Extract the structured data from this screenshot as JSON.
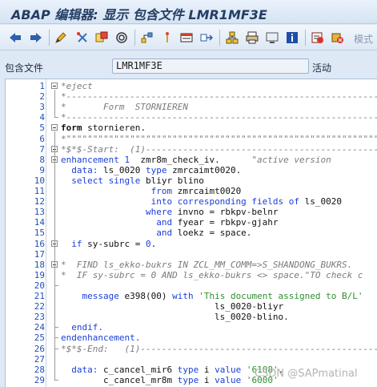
{
  "window": {
    "title": "ABAP 编辑器: 显示 包含文件 LMR1MF3E"
  },
  "toolbar": {
    "mode_label": "模式",
    "icons": [
      "back-arrow-icon",
      "forward-arrow-icon",
      "edit-pencil-icon",
      "toggle-display-change-icon",
      "where-used-icon",
      "check-icon",
      "hierarchy-icon",
      "activate-icon",
      "display-object-list-icon",
      "navigate-icon",
      "structure-icon",
      "print-icon",
      "screen-icon",
      "info-icon",
      "debug-icon",
      "delete-icon"
    ]
  },
  "infobar": {
    "label": "包含文件",
    "name": "LMR1MF3E",
    "status": "活动"
  },
  "lines": [
    {
      "n": "1",
      "fold": true,
      "parts": [
        {
          "c": "cm",
          "t": "*eject"
        }
      ]
    },
    {
      "n": "2",
      "parts": [
        {
          "c": "cm",
          "t": "*---------------------------------------------------------------------"
        }
      ]
    },
    {
      "n": "3",
      "parts": [
        {
          "c": "cm",
          "t": "*       Form  STORNIEREN"
        }
      ]
    },
    {
      "n": "4",
      "parts": [
        {
          "c": "cm",
          "t": "*---------------------------------------------------------------------"
        }
      ]
    },
    {
      "n": "5",
      "fold": true,
      "parts": [
        {
          "c": "bold",
          "t": "form"
        },
        {
          "c": "tx",
          "t": " stornieren."
        }
      ]
    },
    {
      "n": "6",
      "parts": [
        {
          "c": "cm",
          "t": "*\"\"\"\"\"\"\"\"\"\"\"\"\"\"\"\"\"\"\"\"\"\"\"\"\"\"\"\"\"\"\"\"\"\"\"\"\"\"\"\"\"\"\"\"\"\"\"\"\"\"\"\"\"\"\"\"\"\"\"\"\"\"\"\"\""
        }
      ]
    },
    {
      "n": "7",
      "fold": true,
      "parts": [
        {
          "c": "cm",
          "t": "*$*$-Start:  (1)-----------------------------------------------"
        }
      ]
    },
    {
      "n": "8",
      "fold": true,
      "parts": [
        {
          "c": "kw",
          "t": "enhancement"
        },
        {
          "c": "tx",
          "t": " "
        },
        {
          "c": "nm",
          "t": "1"
        },
        {
          "c": "tx",
          "t": "  zmr8m_check_iv.      "
        },
        {
          "c": "cm",
          "t": "\"active version"
        }
      ]
    },
    {
      "n": "9",
      "parts": [
        {
          "c": "tx",
          "t": "  "
        },
        {
          "c": "kw",
          "t": "data:"
        },
        {
          "c": "tx",
          "t": " ls_0020 "
        },
        {
          "c": "kw",
          "t": "type"
        },
        {
          "c": "tx",
          "t": " zmrcaimt0020."
        }
      ]
    },
    {
      "n": "10",
      "parts": [
        {
          "c": "tx",
          "t": "  "
        },
        {
          "c": "kw",
          "t": "select single"
        },
        {
          "c": "tx",
          "t": " bliyr blino"
        }
      ]
    },
    {
      "n": "11",
      "parts": [
        {
          "c": "tx",
          "t": "                 "
        },
        {
          "c": "kw",
          "t": "from"
        },
        {
          "c": "tx",
          "t": " zmrcaimt0020"
        }
      ]
    },
    {
      "n": "12",
      "parts": [
        {
          "c": "tx",
          "t": "                 "
        },
        {
          "c": "kw",
          "t": "into corresponding fields of"
        },
        {
          "c": "tx",
          "t": " ls_0020"
        }
      ]
    },
    {
      "n": "13",
      "parts": [
        {
          "c": "tx",
          "t": "                "
        },
        {
          "c": "kw",
          "t": "where"
        },
        {
          "c": "tx",
          "t": " invno = rbkpv-belnr"
        }
      ]
    },
    {
      "n": "14",
      "parts": [
        {
          "c": "tx",
          "t": "                  "
        },
        {
          "c": "kw",
          "t": "and"
        },
        {
          "c": "tx",
          "t": " fyear = rbkpv-gjahr"
        }
      ]
    },
    {
      "n": "15",
      "parts": [
        {
          "c": "tx",
          "t": "                  "
        },
        {
          "c": "kw",
          "t": "and"
        },
        {
          "c": "tx",
          "t": " loekz = space."
        }
      ]
    },
    {
      "n": "16",
      "fold": true,
      "parts": [
        {
          "c": "tx",
          "t": "  "
        },
        {
          "c": "kw",
          "t": "if"
        },
        {
          "c": "tx",
          "t": " sy-subrc = "
        },
        {
          "c": "nm",
          "t": "0"
        },
        {
          "c": "tx",
          "t": "."
        }
      ]
    },
    {
      "n": "17",
      "parts": []
    },
    {
      "n": "18",
      "fold": true,
      "parts": [
        {
          "c": "cm",
          "t": "*  FIND ls_ekko-bukrs IN ZCL_MM_COMM=>S_SHANDONG_BUKRS."
        }
      ]
    },
    {
      "n": "19",
      "parts": [
        {
          "c": "cm",
          "t": "*  IF sy-subrc = 0 AND ls_ekko-bukrs <> space.\"TO check c"
        }
      ]
    },
    {
      "n": "20",
      "parts": []
    },
    {
      "n": "21",
      "parts": [
        {
          "c": "tx",
          "t": "    "
        },
        {
          "c": "kw",
          "t": "message"
        },
        {
          "c": "tx",
          "t": " e398(00) "
        },
        {
          "c": "kw",
          "t": "with"
        },
        {
          "c": "tx",
          "t": " "
        },
        {
          "c": "st",
          "t": "'This document assigned to B/L'"
        }
      ]
    },
    {
      "n": "22",
      "parts": [
        {
          "c": "tx",
          "t": "                             ls_0020-bliyr"
        }
      ]
    },
    {
      "n": "23",
      "parts": [
        {
          "c": "tx",
          "t": "                             ls_0020-blino."
        }
      ]
    },
    {
      "n": "24",
      "parts": [
        {
          "c": "tx",
          "t": "  "
        },
        {
          "c": "kw",
          "t": "endif."
        }
      ]
    },
    {
      "n": "25",
      "parts": [
        {
          "c": "kw",
          "t": "endenhancement."
        }
      ]
    },
    {
      "n": "26",
      "parts": [
        {
          "c": "cm",
          "t": "*$*$-End:   (1)-----------------------------------------------"
        }
      ]
    },
    {
      "n": "27",
      "parts": []
    },
    {
      "n": "28",
      "parts": [
        {
          "c": "tx",
          "t": "  "
        },
        {
          "c": "kw",
          "t": "data:"
        },
        {
          "c": "tx",
          "t": " c_cancel_mir6 "
        },
        {
          "c": "kw",
          "t": "type"
        },
        {
          "c": "tx",
          "t": " i "
        },
        {
          "c": "kw",
          "t": "value"
        },
        {
          "c": "tx",
          "t": " "
        },
        {
          "c": "st",
          "t": "'6108'"
        },
        {
          "c": "tx",
          "t": ","
        }
      ]
    },
    {
      "n": "29",
      "parts": [
        {
          "c": "tx",
          "t": "        c_cancel_mr8m "
        },
        {
          "c": "kw",
          "t": "type"
        },
        {
          "c": "tx",
          "t": " i "
        },
        {
          "c": "kw",
          "t": "value"
        },
        {
          "c": "tx",
          "t": " "
        },
        {
          "c": "st",
          "t": "'6000'"
        }
      ]
    }
  ],
  "watermark": "CSDN @SAPmatinal"
}
